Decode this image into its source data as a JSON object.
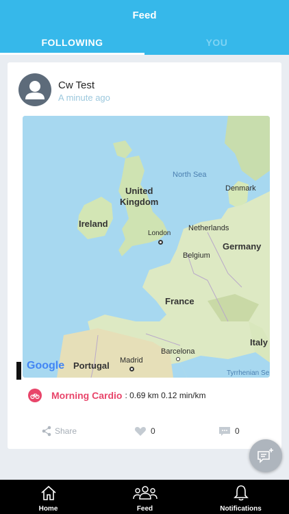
{
  "header": {
    "title": "Feed"
  },
  "tabs": [
    {
      "label": "FOLLOWING",
      "active": true
    },
    {
      "label": "YOU",
      "active": false
    }
  ],
  "post": {
    "user_name": "Cw Test",
    "time": "A minute ago",
    "map": {
      "labels": {
        "north_sea": "North Sea",
        "denmark": "Denmark",
        "united_kingdom": "United\nKingdom",
        "ireland": "Ireland",
        "netherlands": "Netherlands",
        "london": "London",
        "germany": "Germany",
        "belgium": "Belgium",
        "france": "France",
        "italy": "Italy",
        "barcelona": "Barcelona",
        "madrid": "Madrid",
        "portugal": "Portugal",
        "tyrrhenian": "Tyrrhenian Se",
        "google": "Google"
      }
    },
    "activity": {
      "name": "Morning Cardio",
      "stats": ": 0.69 km 0.12 min/km",
      "icon": "bike-icon",
      "color": "#e8456a"
    },
    "actions": {
      "share_label": "Share",
      "likes": "0",
      "comments": "0"
    }
  },
  "bottom_nav": [
    {
      "label": "Home",
      "icon": "home-icon"
    },
    {
      "label": "Feed",
      "icon": "group-icon"
    },
    {
      "label": "Notifications",
      "icon": "bell-icon"
    }
  ],
  "colors": {
    "accent": "#36b8ea",
    "activity": "#e8456a",
    "nav_bg": "#000000"
  }
}
